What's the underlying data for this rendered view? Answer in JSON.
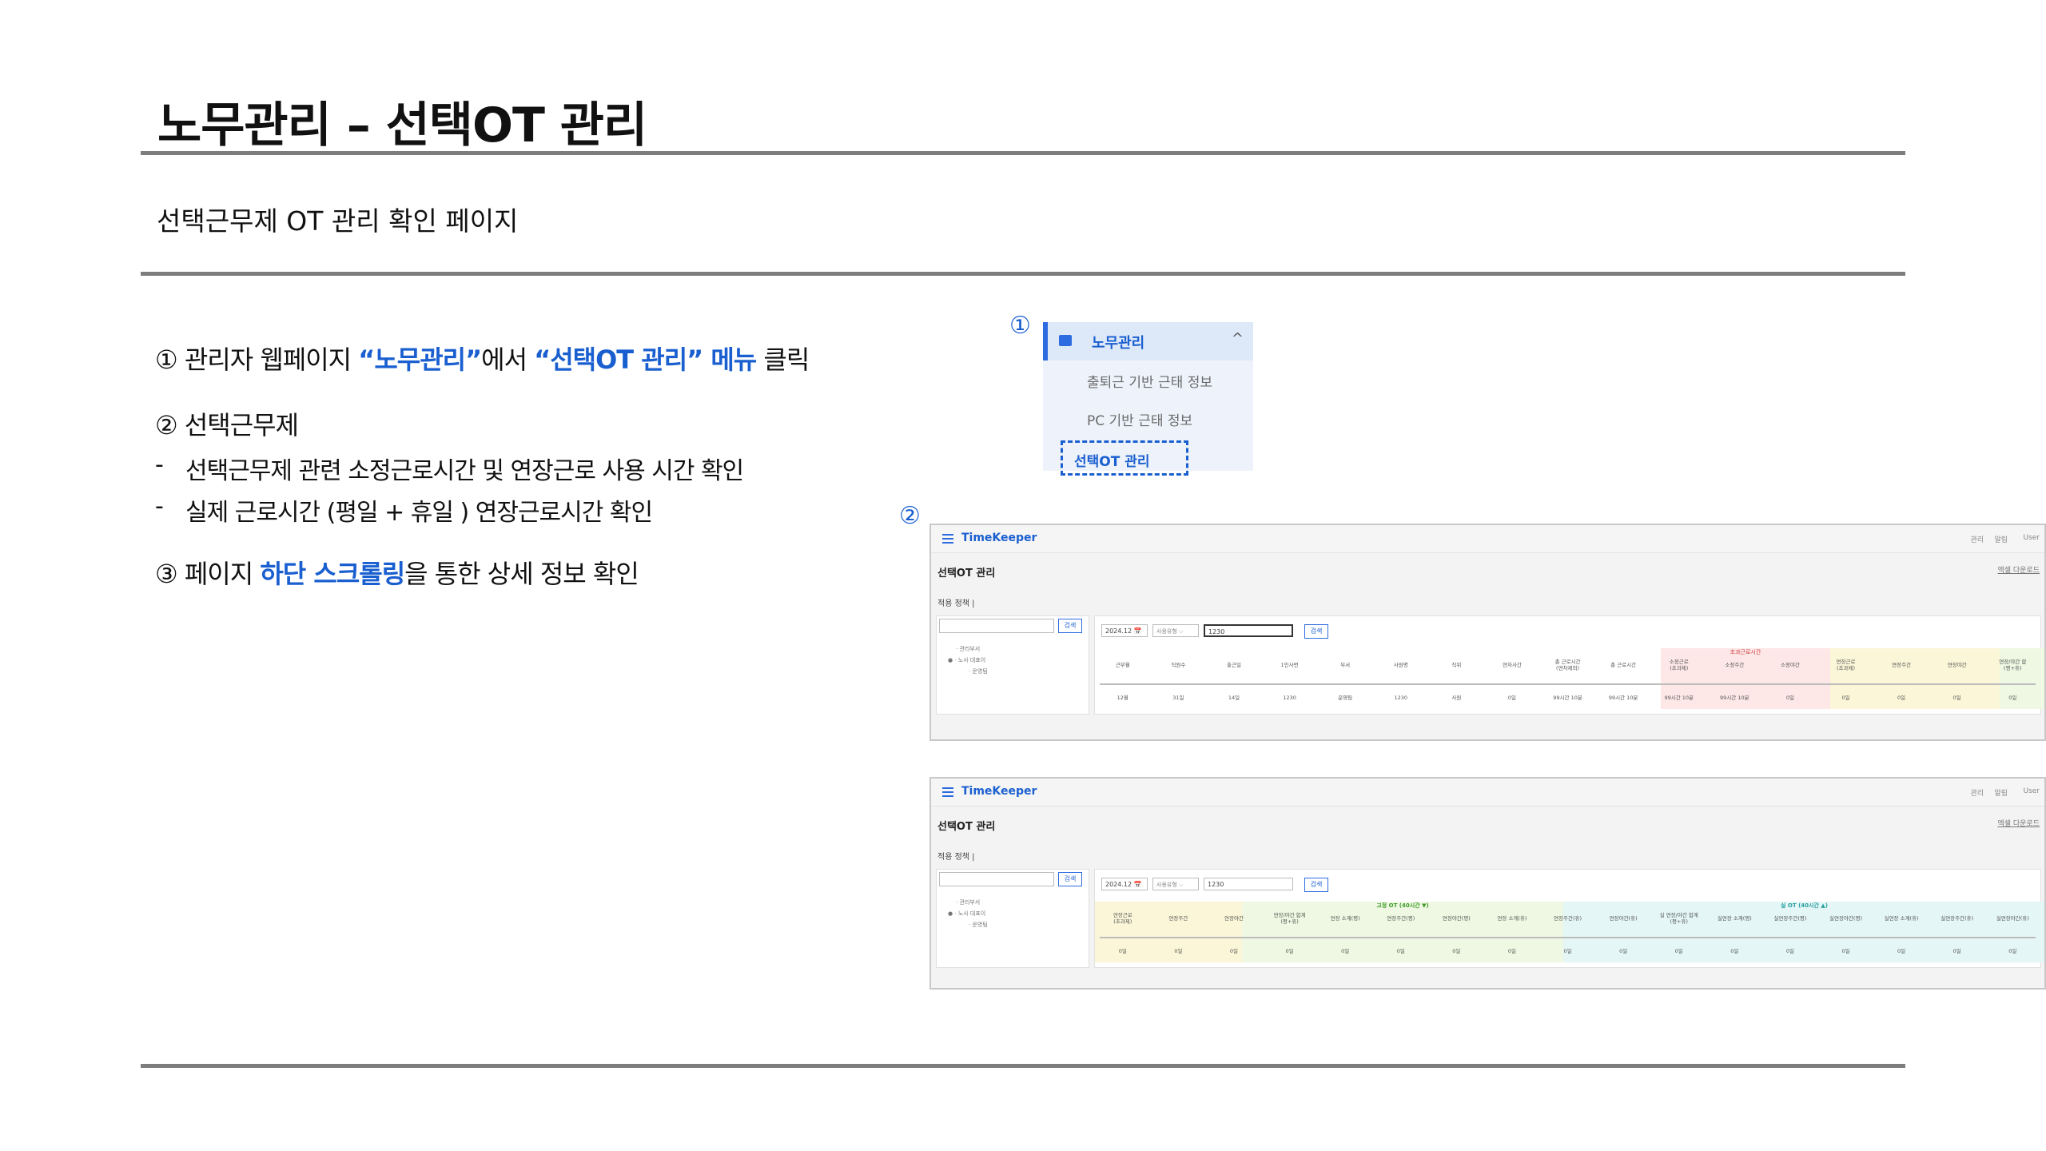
{
  "header": {
    "title": "노무관리 – 선택OT 관리",
    "subtitle": "선택근무제 OT 관리 확인 페이지"
  },
  "steps": {
    "s1": {
      "num": "①",
      "pre": "관리자 웹페이지 ",
      "h1": "“노무관리”",
      "mid": "에서 ",
      "h2": "“선택OT 관리” 메뉴",
      "post": " 클릭"
    },
    "s2": {
      "num": "②",
      "label": "선택근무제"
    },
    "b1": {
      "dash": "-",
      "text": "선택근무제 관련 소정근로시간 및 연장근로 사용 시간 확인"
    },
    "b2": {
      "dash": "-",
      "text": "실제 근로시간 (평일 + 휴일 ) 연장근로시간 확인"
    },
    "s3": {
      "num": "③",
      "pre": " 페이지 ",
      "h": "하단 스크롤링",
      "post": "을 통한 상세 정보 확인"
    }
  },
  "markers": {
    "m1": "①",
    "m2": "②"
  },
  "menu": {
    "header": "노무관리",
    "items": [
      "출퇴근 기반 근태 정보",
      "PC 기반 근태 정보"
    ],
    "selected": "선택OT 관리",
    "chevron": "^"
  },
  "app": {
    "brand": "TimeKeeper",
    "topright": [
      "관리",
      "알림",
      "User"
    ],
    "page_title": "선택OT 관리",
    "page_link": "엑셀 다운로드",
    "sub_label": "적용 정책 |",
    "search_btn": "검색",
    "tree": [
      "· 관리부서",
      "● · 노사 대표이",
      "· 운영팀"
    ],
    "filter": {
      "date": "2024.12 📅",
      "select": "사용유형 ⌵",
      "query": "1230",
      "button": "검색"
    }
  },
  "shot1": {
    "group_label": "초과근로시간",
    "columns": [
      "근무월",
      "직원수",
      "출근일",
      "1인사번",
      "부서",
      "사원명",
      "직위",
      "연차사간",
      "총 근로시간\n(연차제외)",
      "총 근로시간",
      "소정근로\n(초과제)",
      "소정주간",
      "소정야간",
      "연장근로\n(초과제)",
      "연장주간",
      "연장야간",
      "연장/야간 합\n(평+휴)"
    ],
    "values": [
      "12월",
      "31일",
      "14일",
      "1230",
      "운영팀",
      "1230",
      "사원",
      "0일",
      "99시간 10분",
      "99시간 10분",
      "99시간 10분",
      "99시간 10분",
      "0일",
      "0일",
      "0일",
      "0일",
      "0일"
    ]
  },
  "shot2": {
    "group1": "고정 OT (40시간 ▼)",
    "group2": "실 OT (40시간 ▲)",
    "columns": [
      "연장근로\n(초과제)",
      "연장주간",
      "연장야간",
      "연장/야간 합계\n(평+휴)",
      "연장 소계(평)",
      "연장주간(평)",
      "연장야간(평)",
      "연장 소계(휴)",
      "연장주간(휴)",
      "연장야간(휴)",
      "실 연장/야간 합계\n(평+휴)",
      "실연장 소계(평)",
      "실연장주간(평)",
      "실연장야간(평)",
      "실연장 소계(휴)",
      "실연장주간(휴)",
      "실연장야간(휴)"
    ],
    "values": [
      "0일",
      "0일",
      "0일",
      "0일",
      "0일",
      "0일",
      "0일",
      "0일",
      "0일",
      "0일",
      "0일",
      "0일",
      "0일",
      "0일",
      "0일",
      "0일",
      "0일"
    ]
  },
  "colors": {
    "accent": "#1a5fd0",
    "rule": "#7d7d7d",
    "band_red": "#fde7e7",
    "band_yellow": "#fbf6d8",
    "band_green": "#eef8e2",
    "band_cyan": "#e4f6f6"
  }
}
